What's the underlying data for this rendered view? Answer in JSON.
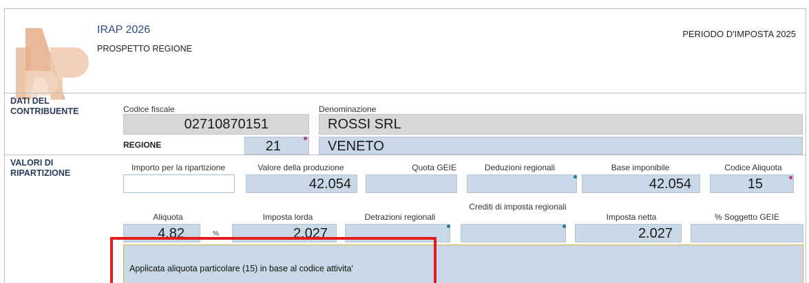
{
  "header": {
    "title": "IRAP 2026",
    "subtitle": "PROSPETTO REGIONE",
    "period": "PERIODO D'IMPOSTA 2025",
    "logo_text": "IRAP"
  },
  "sections": {
    "contribuente": "DATI DEL CONTRIBUENTE",
    "ripartizione": "VALORI DI RIPARTIZIONE"
  },
  "contribuente": {
    "codice_fiscale_label": "Codice fiscale",
    "codice_fiscale": "02710870151",
    "denominazione_label": "Denominazione",
    "denominazione": "ROSSI SRL",
    "regione_label": "REGIONE",
    "regione_code": "21",
    "regione_name": "VENETO"
  },
  "row1": {
    "importo_label": "Importo per la ripartizione",
    "importo": "",
    "valore_label": "Valore della produzione",
    "valore": "42.054",
    "quota_label": "Quota GEIE",
    "quota": "",
    "deduzioni_label": "Deduzioni regionali",
    "deduzioni": "",
    "base_label": "Base imponibile",
    "base": "42.054",
    "codice_aliquota_label": "Codice Aliquota",
    "codice_aliquota": "15"
  },
  "row2": {
    "aliquota_label": "Aliquota",
    "aliquota": "4,82",
    "percent": "%",
    "imposta_lorda_label": "Imposta lorda",
    "imposta_lorda": "2.027",
    "detrazioni_label": "Detrazioni regionali",
    "detrazioni": "",
    "crediti_label": "Crediti di imposta regionali",
    "crediti": "",
    "imposta_netta_label": "Imposta netta",
    "imposta_netta": "2.027",
    "soggetto_label": "% Soggetto GEIE",
    "soggetto": ""
  },
  "message": "Applicata aliquota particolare (15) in base al codice attivita'",
  "colors": {
    "field_blue": "#c9d8e6",
    "field_gray": "#d7d7d7",
    "highlight_red": "#e31b1b",
    "logo_orange": "#e8b89b"
  }
}
